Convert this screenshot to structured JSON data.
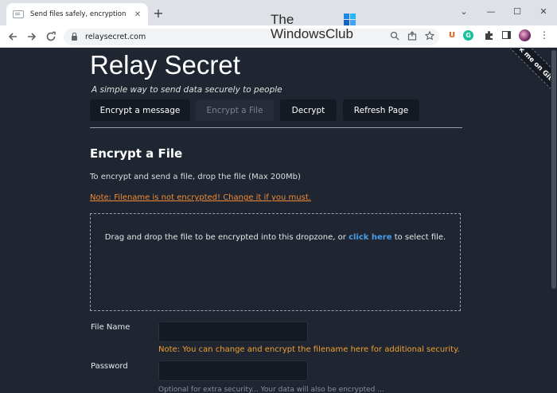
{
  "browser": {
    "tab_title": "Send files safely, encryption done",
    "url": "relaysecret.com",
    "new_tab_label": "+",
    "icons": {
      "back": "arrow-left-icon",
      "forward": "arrow-right-icon",
      "reload": "reload-icon",
      "lock": "lock-icon",
      "zoom": "magnify-icon",
      "share": "share-icon",
      "bookmark": "star-icon",
      "extensions": "puzzle-icon",
      "side_panel": "side-panel-icon",
      "menu": "kebab-menu-icon"
    },
    "extensions": {
      "u_label": "U",
      "g_label": "G"
    }
  },
  "watermark": {
    "line1": "The",
    "line2": "WindowsClub"
  },
  "ribbon": {
    "text": "Fork me on GitHub"
  },
  "site": {
    "title": "Relay Secret",
    "tagline": "A simple way to send data securely to people",
    "nav": [
      {
        "label": "Encrypt a message",
        "state": "normal"
      },
      {
        "label": "Encrypt a File",
        "state": "active-disabled"
      },
      {
        "label": "Decrypt",
        "state": "normal"
      },
      {
        "label": "Refresh Page",
        "state": "normal"
      }
    ]
  },
  "section": {
    "title": "Encrypt a File",
    "instructions": "To encrypt and send a file, drop the file (Max 200Mb)",
    "filename_note": "Note: Filename is not encrypted! Change it if you must."
  },
  "dropzone": {
    "text_before": "Drag and drop the file to be encrypted into this dropzone, or ",
    "link": "click here",
    "text_after": " to select file."
  },
  "form": {
    "file_name_label": "File Name",
    "file_name_value": "",
    "file_name_note": "Note: You can change and encrypt the filename here for additional security.",
    "password_label": "Password",
    "password_value": "",
    "password_hint_partial": "Optional for extra security... Your data will also be encrypted ..."
  },
  "colors": {
    "page_bg": "#1f2631",
    "button_bg": "#141a22",
    "note_orange": "#f08a35",
    "link_blue": "#4a9ee8"
  }
}
